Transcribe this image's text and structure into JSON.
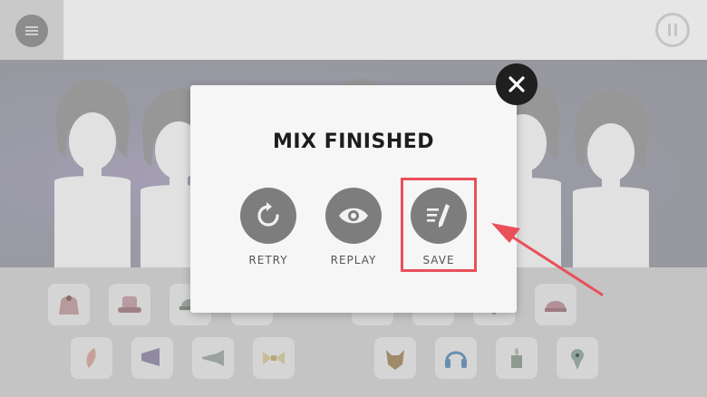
{
  "modal": {
    "title": "MIX FINISHED",
    "actions": [
      {
        "label": "RETRY",
        "icon": "retry-icon"
      },
      {
        "label": "REPLAY",
        "icon": "eye-icon"
      },
      {
        "label": "SAVE",
        "icon": "save-pencil-icon"
      }
    ]
  },
  "colors": {
    "accent": "#e9505a",
    "button": "#7d7d7d",
    "close": "#1f1f1f"
  },
  "icons": {
    "menu": "menu-icon",
    "pause": "pause-icon",
    "close": "close-icon"
  },
  "tray_items": [
    {
      "name": "bag-item"
    },
    {
      "name": "hat-item"
    },
    {
      "name": "cap-item"
    },
    {
      "name": "top-hat-item"
    },
    {
      "name": "mic-item"
    },
    {
      "name": "cassette-item"
    },
    {
      "name": "bottle-item"
    },
    {
      "name": "beanie-item"
    },
    {
      "name": "feather-item"
    },
    {
      "name": "megaphone-item"
    },
    {
      "name": "horn-item"
    },
    {
      "name": "bowtie-item"
    },
    {
      "name": "mask-item"
    },
    {
      "name": "headphones-item"
    },
    {
      "name": "candle-item"
    },
    {
      "name": "ghost-item"
    }
  ]
}
